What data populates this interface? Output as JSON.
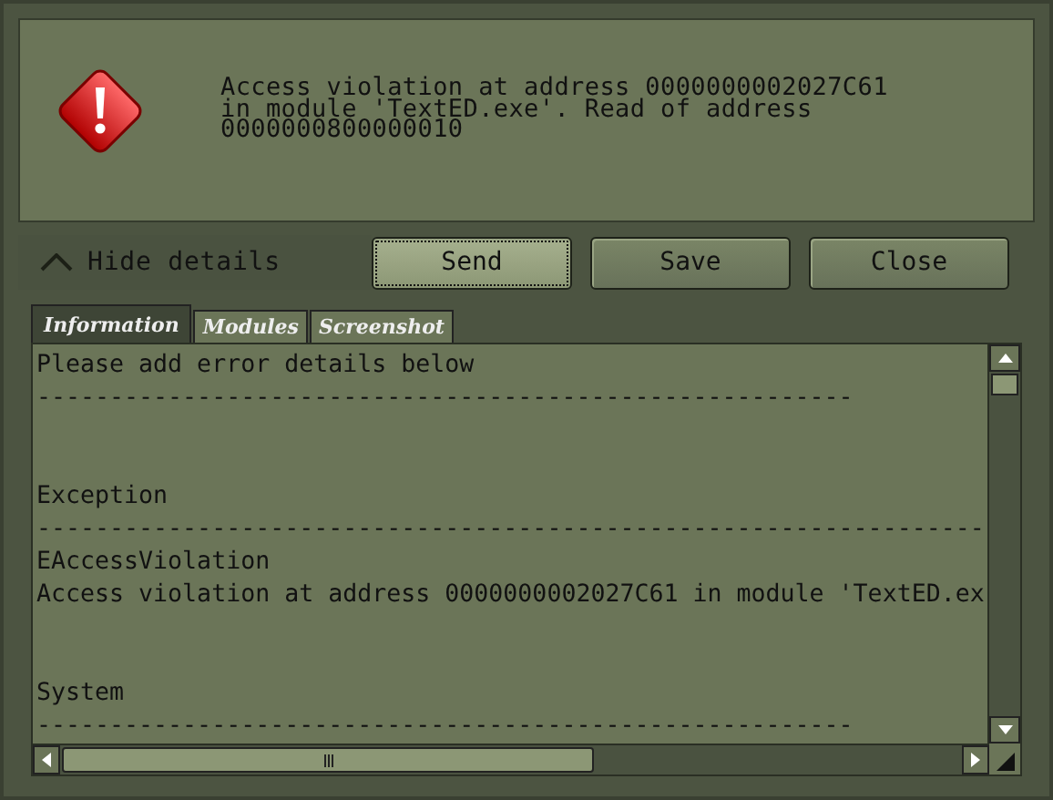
{
  "message": {
    "text": "Access violation at address 0000000002027C61 in module 'TextED.exe'. Read of address 0000000800000010"
  },
  "details_toggle": {
    "label": "Hide details",
    "expanded": true
  },
  "buttons": [
    {
      "label": "Send",
      "focused": true
    },
    {
      "label": "Save",
      "focused": false
    },
    {
      "label": "Close",
      "focused": false
    }
  ],
  "tabs": [
    {
      "label": "Information",
      "selected": true
    },
    {
      "label": "Modules",
      "selected": false
    },
    {
      "label": "Screenshot",
      "selected": false
    }
  ],
  "report": {
    "lines": [
      {
        "kind": "text",
        "text": "Please add error details below"
      },
      {
        "kind": "text",
        "text": "--------------------------------------------------------"
      },
      {
        "kind": "blank"
      },
      {
        "kind": "blank"
      },
      {
        "kind": "text",
        "text": "Exception"
      },
      {
        "kind": "text",
        "text": "-----------------------------------------------------------------"
      },
      {
        "kind": "text",
        "text": "EAccessViolation"
      },
      {
        "kind": "text",
        "text": "Access violation at address 0000000002027C61 in module 'TextED.ex"
      },
      {
        "kind": "blank"
      },
      {
        "kind": "blank"
      },
      {
        "kind": "text",
        "text": "System"
      },
      {
        "kind": "text",
        "text": "--------------------------------------------------------"
      }
    ]
  }
}
